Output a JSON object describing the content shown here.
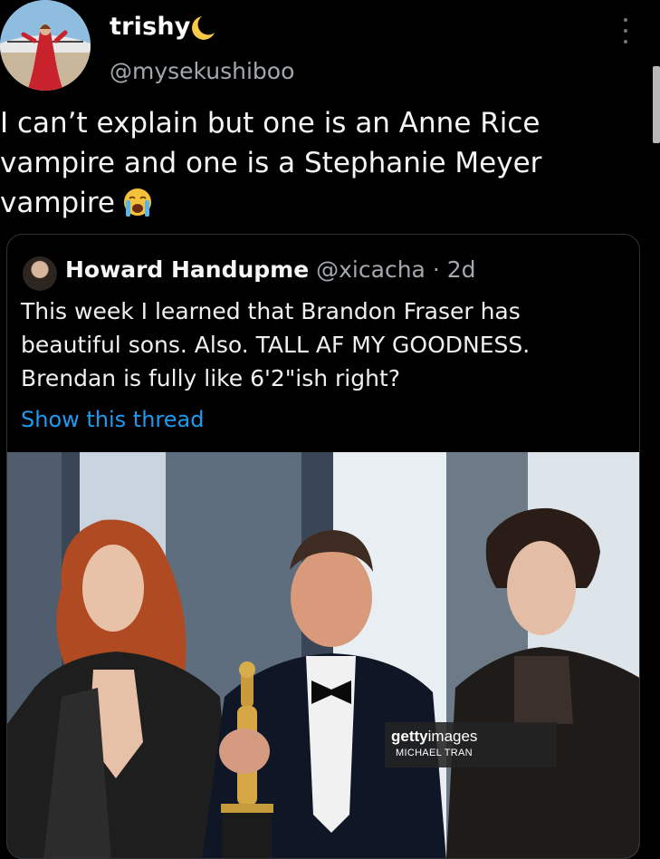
{
  "tweet": {
    "display_name": "trishy",
    "name_emoji": "moon-icon",
    "handle": "@mysekushiboo",
    "text_lines": [
      "I can’t explain but one is an Anne Rice",
      "vampire and one is a Stephanie Meyer",
      "vampire"
    ],
    "text_emoji": "loudly-crying-face-icon"
  },
  "quote": {
    "name": "Howard Handupme",
    "handle": "@xicacha",
    "separator": "·",
    "age": "2d",
    "text_lines": [
      "This week I learned that Brandon Fraser has",
      "beautiful sons. Also. TALL AF MY GOODNESS.",
      "Brendan is fully like 6'2\"ish right?"
    ],
    "show_thread": "Show this thread",
    "photo_watermark": {
      "brand_bold": "getty",
      "brand_rest": "images",
      "credit": "MICHAEL TRAN"
    }
  },
  "colors": {
    "background": "#000000",
    "link": "#1d9bf0",
    "secondary_text": "#a3a8ad"
  }
}
